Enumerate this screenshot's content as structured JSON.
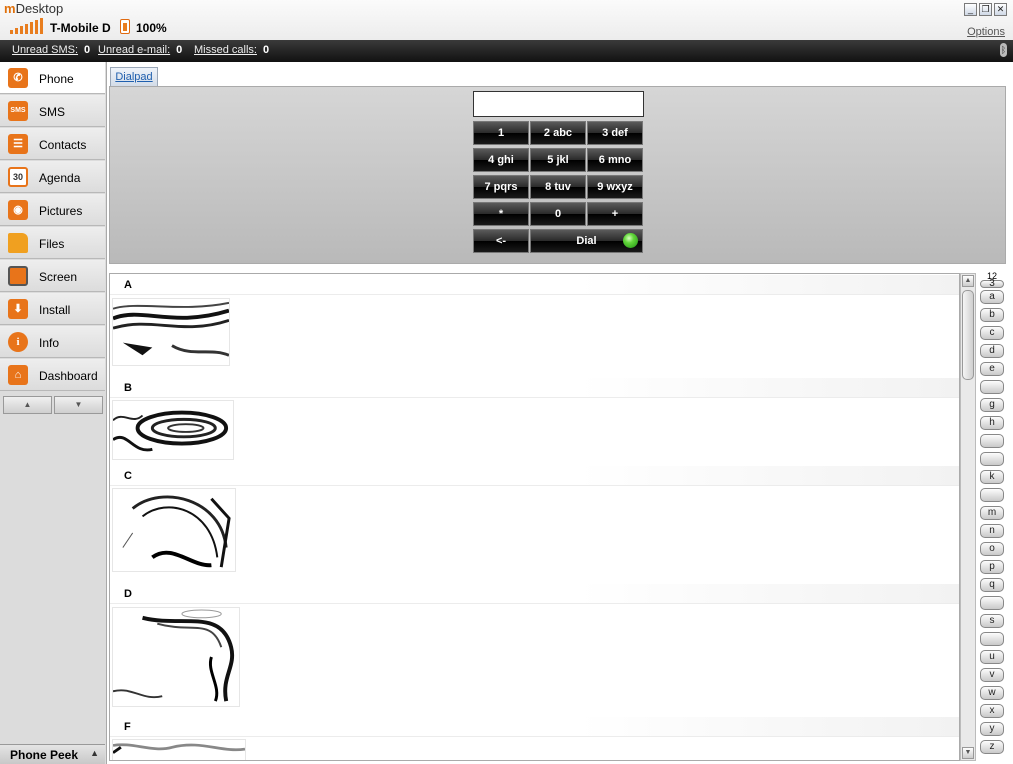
{
  "window": {
    "title_m": "m",
    "title_rest": "Desktop",
    "options_label": "Options",
    "minimize_glyph": "_",
    "restore_glyph": "❐",
    "close_glyph": "✕"
  },
  "device": {
    "carrier": "T-Mobile D",
    "battery": "100%"
  },
  "status": {
    "unread_sms_label": "Unread SMS:",
    "unread_sms": "0",
    "unread_email_label": "Unread e-mail:",
    "unread_email": "0",
    "missed_calls_label": "Missed calls:",
    "missed_calls": "0"
  },
  "sidebar": {
    "items": [
      {
        "label": "Phone",
        "icon": "phone-icon",
        "color": "#e8741a"
      },
      {
        "label": "SMS",
        "icon": "sms-icon",
        "color": "#e8741a"
      },
      {
        "label": "Contacts",
        "icon": "contacts-icon",
        "color": "#e8741a"
      },
      {
        "label": "Agenda",
        "icon": "calendar-icon",
        "color": "#e8741a"
      },
      {
        "label": "Pictures",
        "icon": "camera-icon",
        "color": "#e8741a"
      },
      {
        "label": "Files",
        "icon": "folder-icon",
        "color": "#f0a020"
      },
      {
        "label": "Screen",
        "icon": "monitor-icon",
        "color": "#e8741a"
      },
      {
        "label": "Install",
        "icon": "install-icon",
        "color": "#e8741a"
      },
      {
        "label": "Info",
        "icon": "info-icon",
        "color": "#e8741a"
      },
      {
        "label": "Dashboard",
        "icon": "home-icon",
        "color": "#e8741a"
      }
    ],
    "agenda_day": "30",
    "sms_badge": "SMS",
    "info_glyph": "i",
    "up_glyph": "▲",
    "down_glyph": "▼",
    "peek_label": "Phone Peek",
    "peek_arrow": "▲"
  },
  "tabs": {
    "dialpad": "Dialpad"
  },
  "dialpad": {
    "input_value": "",
    "keys": [
      [
        "1",
        "2 abc",
        "3 def"
      ],
      [
        "4 ghi",
        "5 jkl",
        "6 mno"
      ],
      [
        "7 pqrs",
        "8 tuv",
        "9 wxyz"
      ],
      [
        "*",
        "0",
        "+"
      ]
    ],
    "backspace": "<-",
    "dial": "Dial"
  },
  "contacts": {
    "groups": [
      "A",
      "B",
      "C",
      "D",
      "F"
    ]
  },
  "scrollbar": {
    "up_glyph": "▲",
    "down_glyph": "▼"
  },
  "alphabet": {
    "top": "12",
    "letters": [
      "3",
      "a",
      "b",
      "c",
      "d",
      "e",
      "",
      "g",
      "h",
      "",
      "",
      "k",
      "",
      "m",
      "n",
      "o",
      "p",
      "q",
      "",
      "s",
      "",
      "u",
      "v",
      "w",
      "x",
      "y",
      "z"
    ]
  },
  "colors": {
    "accent": "#e8741a",
    "status_bar": "#1e1e1e",
    "dial_led": "#3cc020"
  }
}
